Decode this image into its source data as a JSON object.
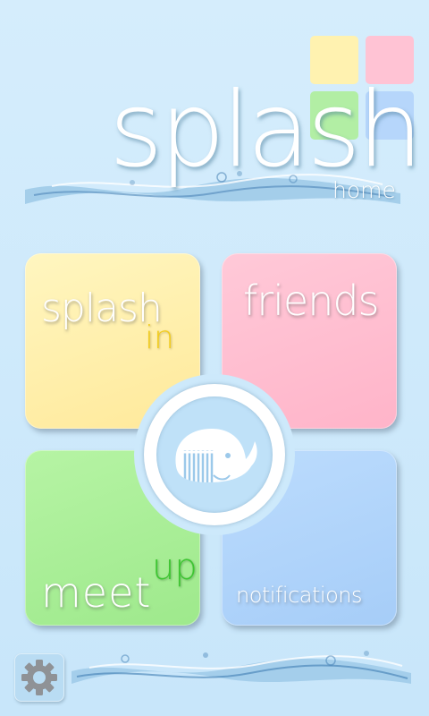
{
  "header": {
    "title": "splash",
    "subtitle": "home"
  },
  "tiles": {
    "splash_in": {
      "word1": "splash",
      "word2": "in"
    },
    "friends": {
      "label": "friends"
    },
    "meet_up": {
      "word1": "meet",
      "word2": "up"
    },
    "notifications": {
      "label": "notifications"
    }
  },
  "icons": {
    "center": "whale-icon",
    "settings": "gear-icon"
  },
  "colors": {
    "background": "#cde9fb",
    "yellow": "#fff2b0",
    "pink": "#ffc3d4",
    "green": "#b2eea4",
    "blue": "#b6d6fb",
    "in_accent": "#f2cc20",
    "up_accent": "#3ec632"
  }
}
